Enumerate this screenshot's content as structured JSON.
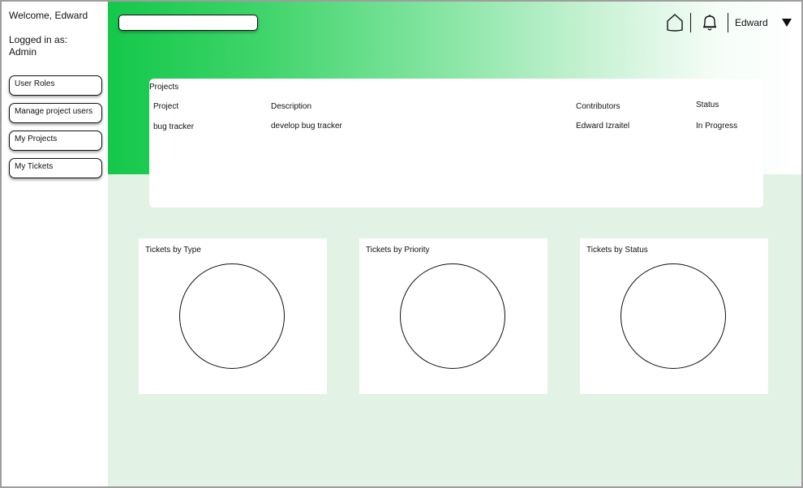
{
  "sidebar": {
    "welcome": "Welcome, Edward",
    "logged_in_label": "Logged in as:",
    "role": "Admin",
    "items": [
      {
        "label": "User Roles"
      },
      {
        "label": "Manage project users"
      },
      {
        "label": "My Projects"
      },
      {
        "label": "My Tickets"
      }
    ]
  },
  "header": {
    "search_value": "",
    "icons": [
      "home-icon",
      "bell-icon",
      "caret-down-icon"
    ],
    "user_name": "Edward"
  },
  "projects": {
    "title": "Projects",
    "columns": [
      "Project",
      "Description",
      "Contributors",
      "Status"
    ],
    "rows": [
      [
        "bug tracker",
        "develop bug tracker",
        "Edward Izraitel",
        "In Progress"
      ]
    ]
  },
  "charts": [
    {
      "title": "Tickets by Type"
    },
    {
      "title": "Tickets by Priority"
    },
    {
      "title": "Tickets by Status"
    }
  ],
  "colors": {
    "accent": "#13c84a",
    "background": "#e2f3e6"
  }
}
